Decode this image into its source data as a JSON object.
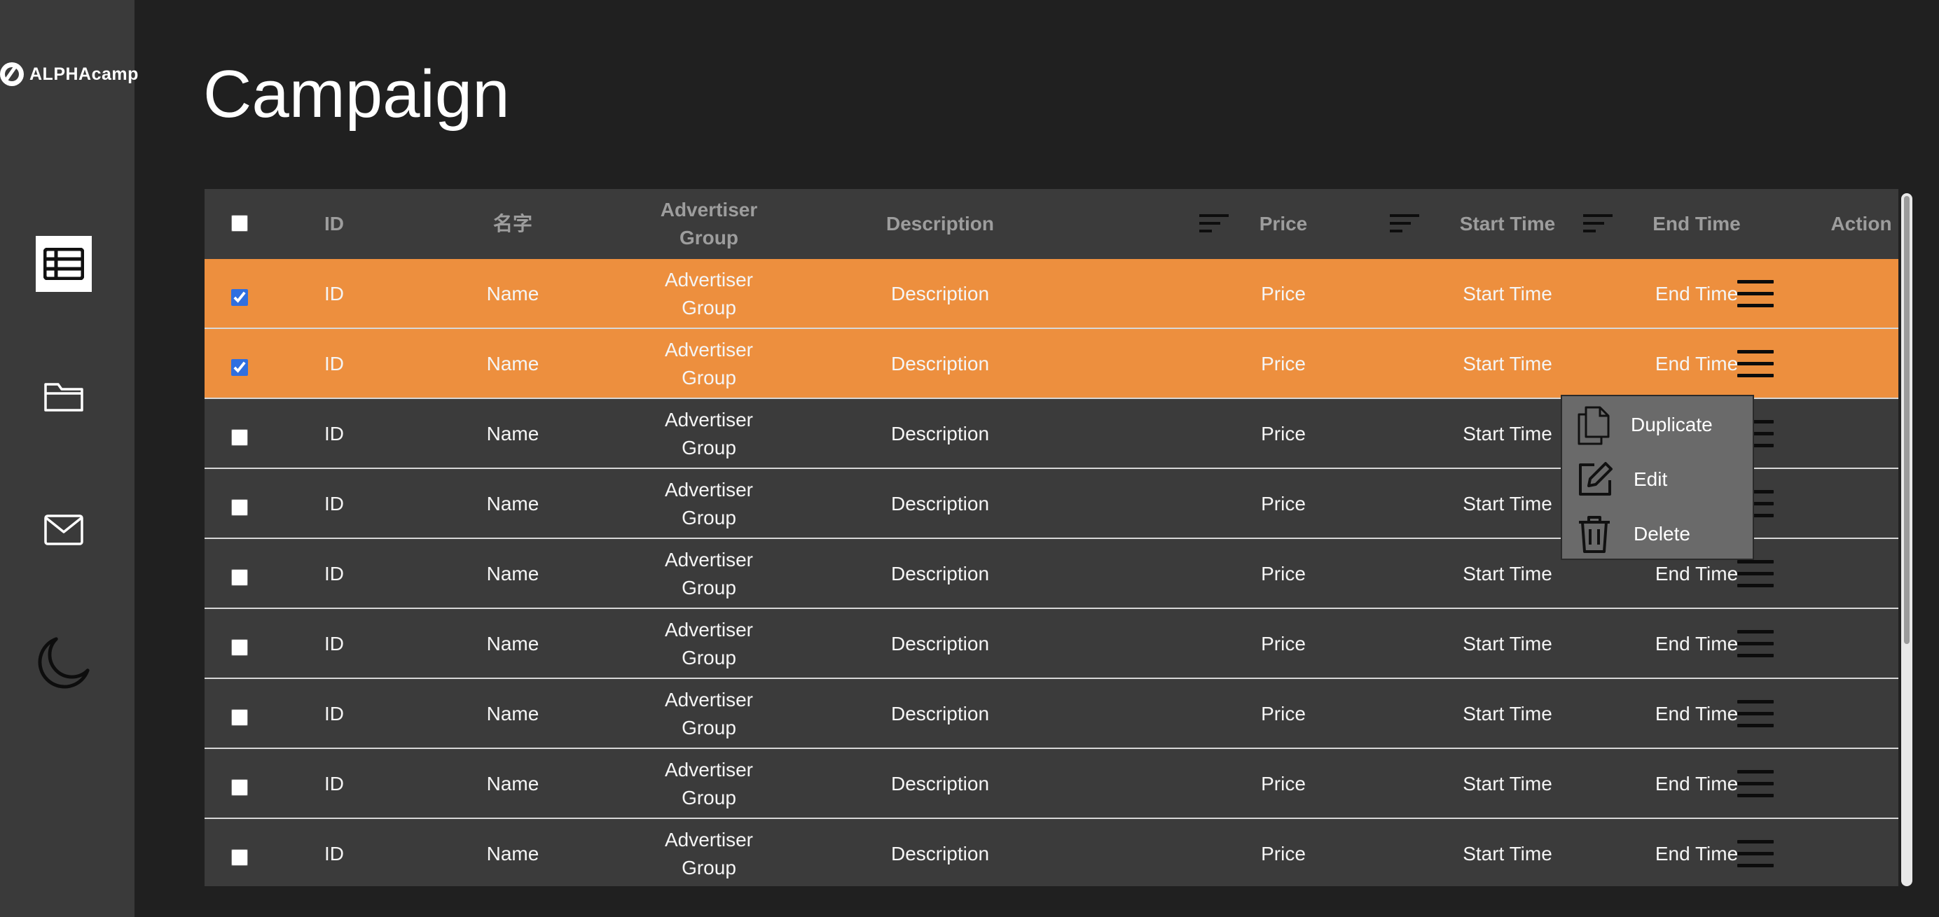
{
  "brand": {
    "logo_text": "ALPHAcamp"
  },
  "sidebar": {
    "items": [
      {
        "name": "table",
        "icon": "table-icon",
        "active": true
      },
      {
        "name": "folder",
        "icon": "folder-icon",
        "active": false
      },
      {
        "name": "mail",
        "icon": "mail-icon",
        "active": false
      },
      {
        "name": "theme",
        "icon": "moon-icon",
        "active": false
      }
    ]
  },
  "page": {
    "title": "Campaign"
  },
  "table": {
    "headers": {
      "id": "ID",
      "name": "名字",
      "advertiser_line1": "Advertiser",
      "advertiser_line2": "Group",
      "description": "Description",
      "price": "Price",
      "start_time": "Start Time",
      "end_time": "End Time",
      "action": "Action"
    },
    "rows": [
      {
        "selected": true,
        "id": "ID",
        "name": "Name",
        "adv1": "Advertiser",
        "adv2": "Group",
        "description": "Description",
        "price": "Price",
        "start": "Start Time",
        "end": "End Time"
      },
      {
        "selected": true,
        "id": "ID",
        "name": "Name",
        "adv1": "Advertiser",
        "adv2": "Group",
        "description": "Description",
        "price": "Price",
        "start": "Start Time",
        "end": "End Time"
      },
      {
        "selected": false,
        "id": "ID",
        "name": "Name",
        "adv1": "Advertiser",
        "adv2": "Group",
        "description": "Description",
        "price": "Price",
        "start": "Start Time",
        "end": "End Time"
      },
      {
        "selected": false,
        "id": "ID",
        "name": "Name",
        "adv1": "Advertiser",
        "adv2": "Group",
        "description": "Description",
        "price": "Price",
        "start": "Start Time",
        "end": "End Time"
      },
      {
        "selected": false,
        "id": "ID",
        "name": "Name",
        "adv1": "Advertiser",
        "adv2": "Group",
        "description": "Description",
        "price": "Price",
        "start": "Start Time",
        "end": "End Time"
      },
      {
        "selected": false,
        "id": "ID",
        "name": "Name",
        "adv1": "Advertiser",
        "adv2": "Group",
        "description": "Description",
        "price": "Price",
        "start": "Start Time",
        "end": "End Time"
      },
      {
        "selected": false,
        "id": "ID",
        "name": "Name",
        "adv1": "Advertiser",
        "adv2": "Group",
        "description": "Description",
        "price": "Price",
        "start": "Start Time",
        "end": "End Time"
      },
      {
        "selected": false,
        "id": "ID",
        "name": "Name",
        "adv1": "Advertiser",
        "adv2": "Group",
        "description": "Description",
        "price": "Price",
        "start": "Start Time",
        "end": "End Time"
      },
      {
        "selected": false,
        "id": "ID",
        "name": "Name",
        "adv1": "Advertiser",
        "adv2": "Group",
        "description": "Description",
        "price": "Price",
        "start": "Start Time",
        "end": "End Time"
      }
    ]
  },
  "action_menu": {
    "items": [
      {
        "label": "Duplicate",
        "icon": "duplicate-icon"
      },
      {
        "label": "Edit",
        "icon": "edit-icon"
      },
      {
        "label": "Delete",
        "icon": "trash-icon"
      }
    ]
  },
  "colors": {
    "selected_row": "#ed8f3e",
    "row_bg": "#3b3b3b",
    "page_bg": "#202020",
    "sidebar_bg": "#3a3a3a",
    "menu_bg": "#6a6a6a"
  }
}
